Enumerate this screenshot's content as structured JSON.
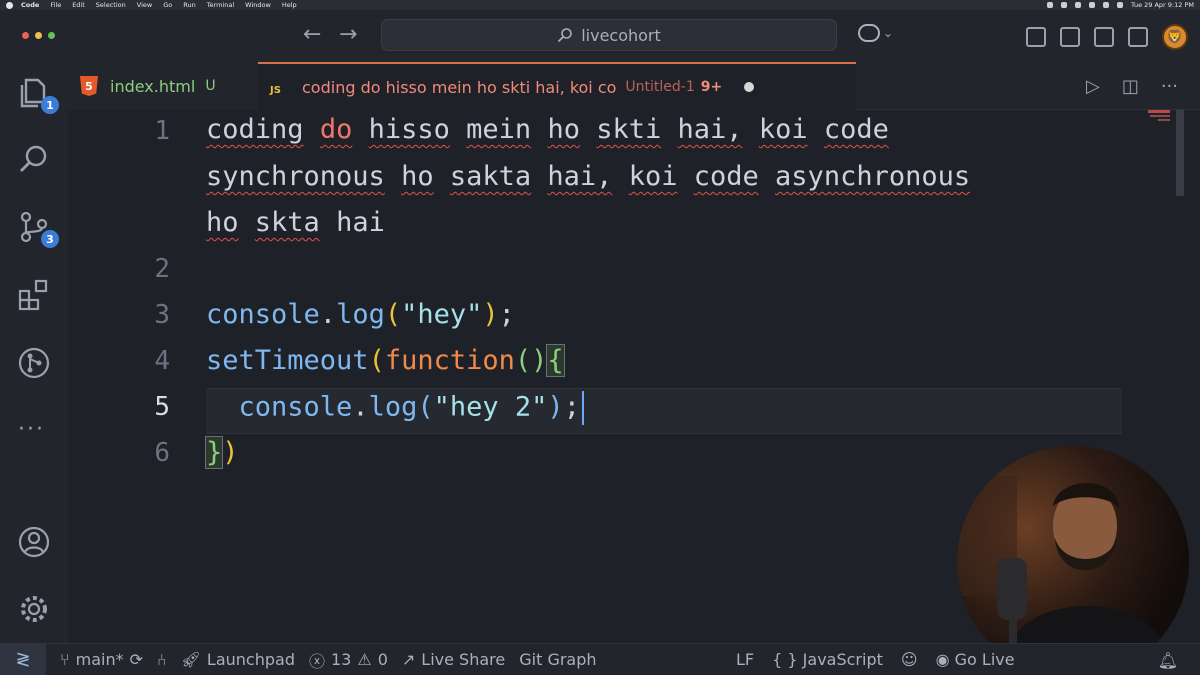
{
  "menubar": {
    "app": "Code",
    "items": [
      "File",
      "Edit",
      "Selection",
      "View",
      "Go",
      "Run",
      "Terminal",
      "Window",
      "Help"
    ],
    "clock": "Tue 29 Apr 9:12 PM"
  },
  "titlebar": {
    "search_text": "livecohort"
  },
  "activity": {
    "explorer_badge": "1",
    "scm_badge": "3"
  },
  "tabs": [
    {
      "label": "index.html",
      "status": "U",
      "icon": "html5-icon"
    },
    {
      "label": "coding do hisso mein ho skti hai, koi co",
      "description": "Untitled-1",
      "problems": "9+",
      "icon": "js-icon"
    }
  ],
  "editor": {
    "line_numbers": [
      "1",
      "2",
      "3",
      "4",
      "5",
      "6"
    ],
    "active_line": "5",
    "line1": {
      "row1": [
        "coding",
        "do",
        "hisso",
        "mein",
        "ho",
        "skti",
        "hai,",
        "koi",
        "code"
      ],
      "row2": [
        "synchronous",
        "ho",
        "sakta",
        "hai,",
        "koi",
        "code",
        "asynchronous"
      ],
      "row3": [
        "ho",
        "skta",
        "hai"
      ]
    },
    "line3": {
      "obj": "console",
      "dot": ".",
      "method": "log",
      "open": "(",
      "arg": "\"hey\"",
      "close": ")",
      "semi": ";"
    },
    "line4": {
      "fn": "setTimeout",
      "open": "(",
      "kw": "function",
      "params": "()",
      "brace": "{"
    },
    "line5": {
      "obj": "console",
      "dot": ".",
      "method": "log",
      "open": "(",
      "arg": "\"hey 2\"",
      "close": ")",
      "semi": ";"
    },
    "line6": {
      "brace": "}",
      "close": ")"
    }
  },
  "statusbar": {
    "branch": "main*",
    "launchpad": "Launchpad",
    "errors": "13",
    "warnings": "0",
    "liveshare": "Live Share",
    "gitgraph": "Git Graph",
    "eol": "LF",
    "language": "JavaScript",
    "golive": "Go Live"
  },
  "colors": {
    "accent_tab": "#d5734a",
    "badge": "#3b7cd6",
    "error_squiggle": "#e0524a"
  }
}
